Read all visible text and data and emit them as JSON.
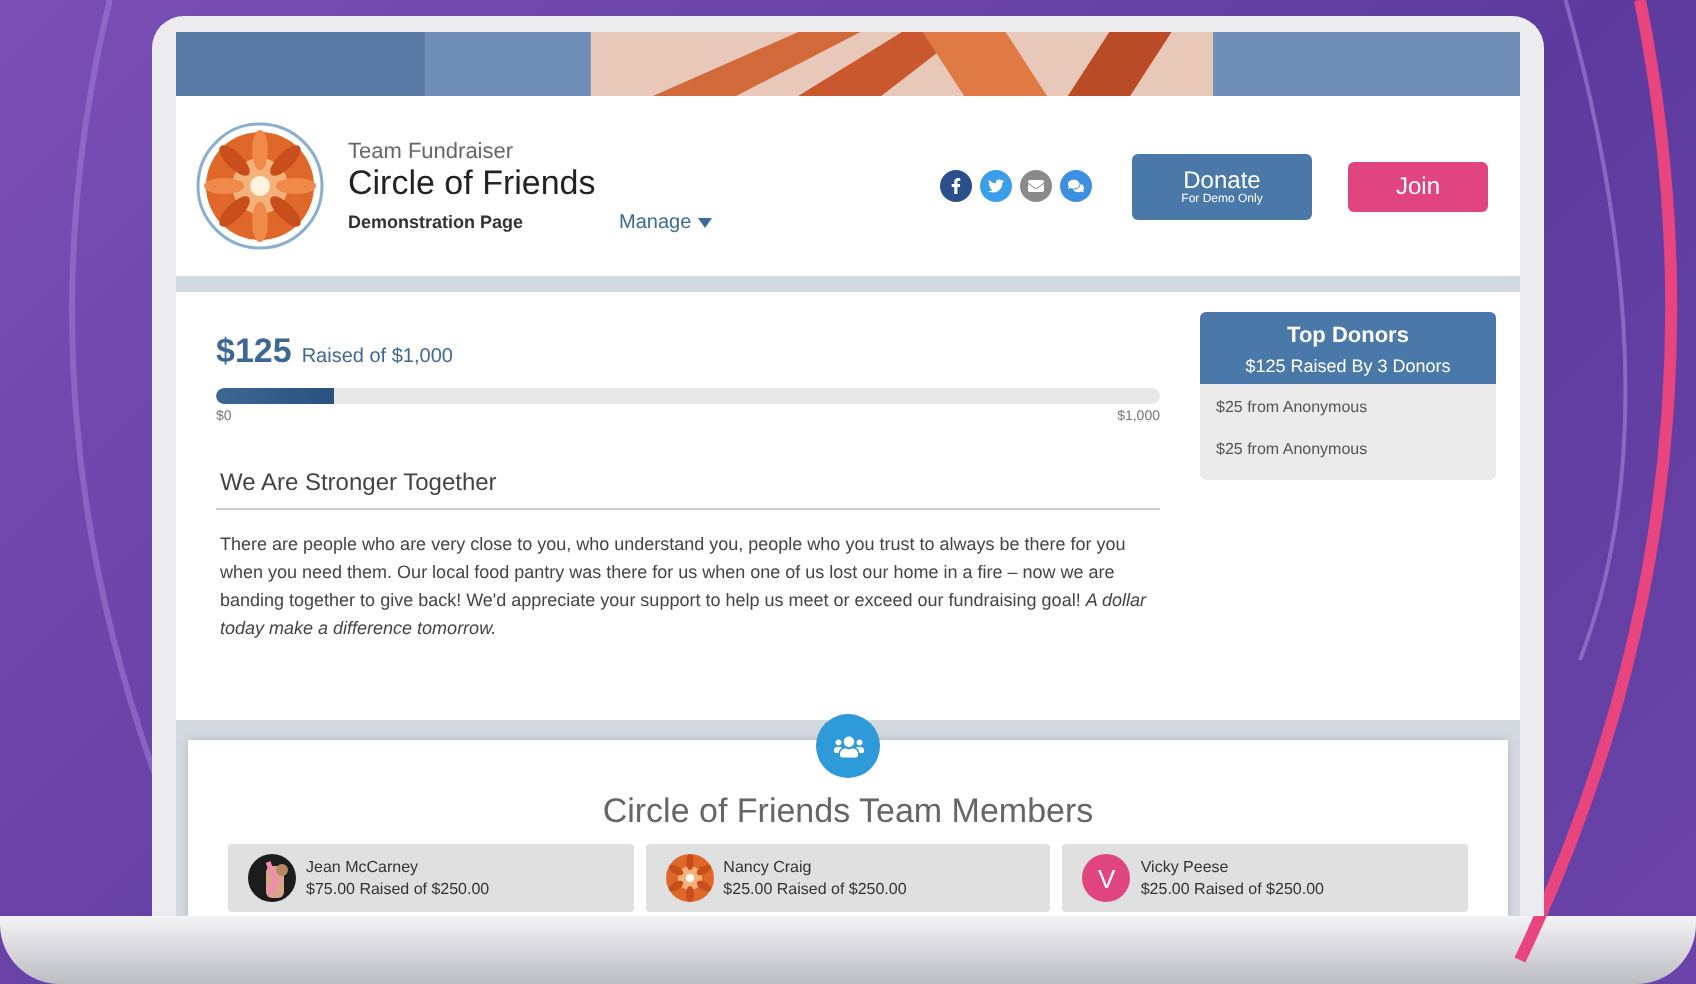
{
  "header": {
    "eyebrow": "Team Fundraiser",
    "title": "Circle of Friends",
    "subtitle": "Demonstration Page",
    "manage": "Manage",
    "social": [
      {
        "kind": "facebook",
        "color": "#2d4e8c"
      },
      {
        "kind": "twitter",
        "color": "#3a9ee8"
      },
      {
        "kind": "email",
        "color": "#8a8a8a"
      },
      {
        "kind": "chat",
        "color": "#3f8fe0"
      }
    ],
    "donate": {
      "label": "Donate",
      "note": "For Demo Only"
    },
    "join": "Join"
  },
  "progress": {
    "raised": "$125",
    "of": "Raised of $1,000",
    "level": 0.125,
    "min": "$0",
    "max": "$1,000"
  },
  "story": {
    "heading": "We Are Stronger Together",
    "body": "There are people who are very close to you, who understand you, people who you trust to always be there for you when you need them. Our local food pantry was there for us when one of us lost our home in a fire – now we are banding together to give back!  We'd appreciate your support to help us meet or exceed our fundraising goal!  *A dollar today make a difference tomorrow.*"
  },
  "donors": {
    "title": "Top Donors",
    "summary": "$125 Raised By 3 Donors",
    "items": [
      "$25 from Anonymous",
      "$25 from Anonymous"
    ]
  },
  "team": {
    "title": "Circle of Friends Team Members",
    "members": [
      {
        "name": "Jean McCarney",
        "raised": "$75.00 Raised of $250.00"
      },
      {
        "name": "Nancy Craig",
        "raised": "$25.00 Raised of $250.00"
      },
      {
        "name": "Vicky Peese",
        "raised": "$25.00 Raised of $250.00",
        "avatar": {
          "kind": "letter",
          "letter": "V",
          "color": "#e0457f"
        }
      }
    ]
  }
}
